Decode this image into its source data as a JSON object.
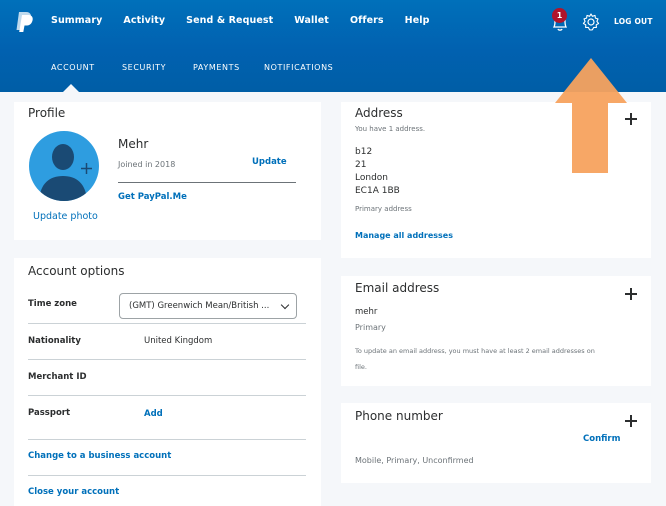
{
  "header": {
    "nav": [
      "Summary",
      "Activity",
      "Send & Request",
      "Wallet",
      "Offers",
      "Help"
    ],
    "notification_count": "1",
    "logout_label": "LOG OUT",
    "logo_icon": "paypal-logo",
    "bell_icon": "bell-icon",
    "gear_icon": "gear-icon"
  },
  "subnav": {
    "tabs": [
      "ACCOUNT",
      "SECURITY",
      "PAYMENTS",
      "NOTIFICATIONS"
    ],
    "active": "ACCOUNT"
  },
  "profile": {
    "title": "Profile",
    "name": "Mehr",
    "joined": "Joined in 2018",
    "update_label": "Update",
    "paypal_me_label": "Get PayPal.Me",
    "update_photo_label": "Update photo"
  },
  "account_options": {
    "title": "Account options",
    "timezone_label": "Time zone",
    "timezone_value": "(GMT) Greenwich Mean/British ...",
    "nationality_label": "Nationality",
    "nationality_value": "United Kingdom",
    "merchant_label": "Merchant ID",
    "passport_label": "Passport",
    "passport_add": "Add",
    "business_link": "Change to a business account",
    "close_link": "Close your account"
  },
  "address": {
    "title": "Address",
    "count_text": "You have 1 address.",
    "lines": [
      "b12",
      "21",
      "London",
      "EC1A 1BB"
    ],
    "primary_text": "Primary address",
    "manage_link": "Manage all addresses"
  },
  "email": {
    "title": "Email address",
    "value": "mehr",
    "primary_text": "Primary",
    "note_line1": "To update an email address, you must have at least 2 email addresses on",
    "note_line2": "file."
  },
  "phone": {
    "title": "Phone number",
    "confirm_label": "Confirm",
    "status": "Mobile, Primary, Unconfirmed"
  },
  "colors": {
    "brand_blue": "#0070ba",
    "badge_red": "#b0142b",
    "arrow_orange": "#f7a25e"
  }
}
